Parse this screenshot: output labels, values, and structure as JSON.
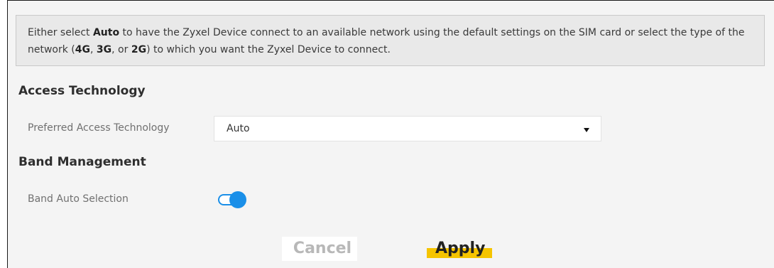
{
  "info": {
    "p1": "Either select ",
    "b1": "Auto",
    "p2": " to have the Zyxel Device connect to an available network using the default settings on the SIM card or select the type of the network (",
    "b2": "4G",
    "p3": ", ",
    "b3": "3G",
    "p4": ", or ",
    "b4": "2G",
    "p5": ") to which you want the Zyxel Device to connect."
  },
  "access_technology": {
    "title": "Access Technology",
    "preferred_label": "Preferred Access Technology",
    "preferred_value": "Auto"
  },
  "band_management": {
    "title": "Band Management",
    "auto_selection_label": "Band Auto Selection",
    "auto_selection_enabled": true
  },
  "buttons": {
    "cancel": "Cancel",
    "apply": "Apply"
  },
  "colors": {
    "toggle_on": "#1a8fe8",
    "apply_highlight": "#f5c400"
  }
}
